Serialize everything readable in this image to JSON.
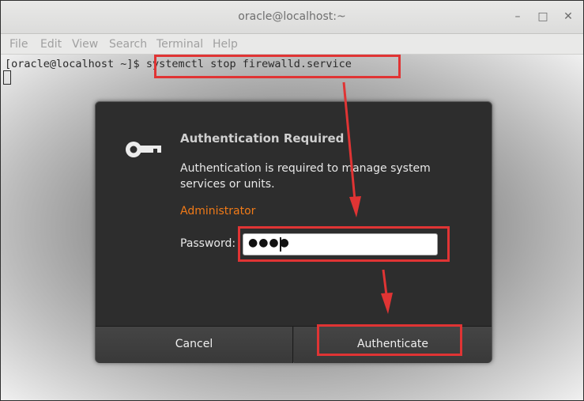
{
  "window": {
    "title": "oracle@localhost:~",
    "controls": {
      "minimize": "–",
      "maximize": "□",
      "close": "✕"
    }
  },
  "menubar": {
    "items": [
      "File",
      "Edit",
      "View",
      "Search",
      "Terminal",
      "Help"
    ]
  },
  "terminal": {
    "prompt": "[oracle@localhost ~]$ ",
    "command": "systemctl stop firewalld.service"
  },
  "dialog": {
    "icon": "key-icon",
    "title": "Authentication Required",
    "description": "Authentication is required to manage system services or units.",
    "user": "Administrator",
    "password_label": "Password:",
    "password_value": "●●●●",
    "cancel_label": "Cancel",
    "authenticate_label": "Authenticate"
  },
  "colors": {
    "highlight": "#e03434",
    "user_accent": "#f07a18",
    "dialog_bg": "#2d2d2d"
  }
}
